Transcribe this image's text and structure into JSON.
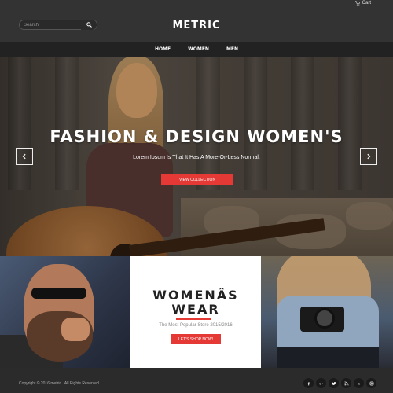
{
  "topbar": {
    "cart_label": "Cart",
    "cart_icon": "cart-icon"
  },
  "header": {
    "search_placeholder": "Search",
    "search_icon": "search-icon",
    "logo": "METRIC"
  },
  "nav": {
    "items": [
      "HOME",
      "WOMEN",
      "MEN"
    ]
  },
  "hero": {
    "title": "FASHION & DESIGN WOMEN'S",
    "subtitle": "Lorem Ipsum Is That It Has A More-Or-Less Normal.",
    "button_label": "VIEW COLLECTION",
    "prev_icon": "chevron-left-icon",
    "next_icon": "chevron-right-icon"
  },
  "promo": {
    "title_line1": "WOMENÂS",
    "title_line2": "WEAR",
    "subtitle": "The Most Popular Store 2015/2016",
    "button_label": "LET'S SHOP NOW!"
  },
  "footer": {
    "copyright": "Copyright © 2016 metric . All Rights Reserved",
    "social": [
      "facebook-icon",
      "google-plus-icon",
      "twitter-icon",
      "rss-icon",
      "linkedin-icon",
      "instagram-icon"
    ]
  },
  "colors": {
    "accent": "#e53935",
    "header_bg": "#333333",
    "nav_bg": "#222222",
    "footer_bg": "#2b2b2b"
  }
}
